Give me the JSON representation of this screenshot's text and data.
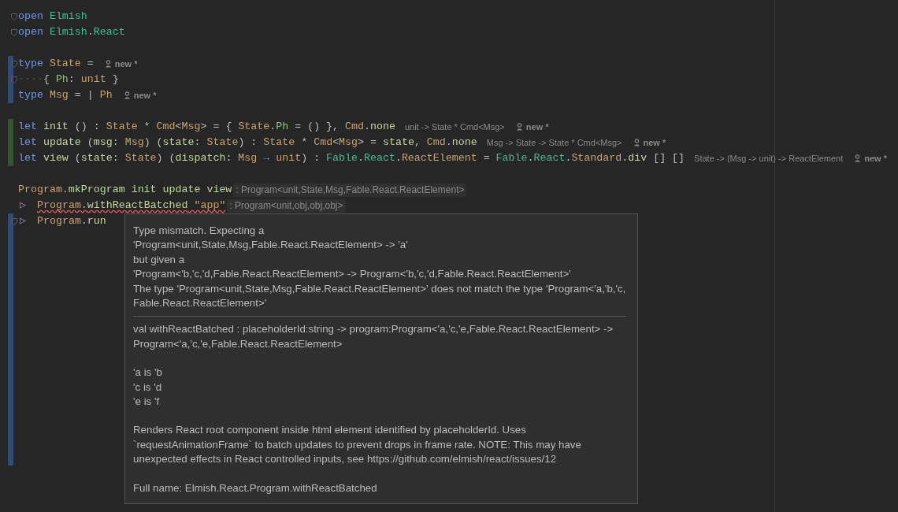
{
  "editor": {
    "blocks": [
      {
        "lines": [
          {
            "fold": true,
            "tokens": [
              {
                "kind": "kw",
                "text": "open "
              },
              {
                "kind": "mod",
                "text": "Elmish"
              }
            ]
          },
          {
            "fold": true,
            "tokens": [
              {
                "kind": "kw",
                "text": "open "
              },
              {
                "kind": "mod",
                "text": "Elmish"
              },
              {
                "kind": "p",
                "text": "."
              },
              {
                "kind": "mod",
                "text": "React"
              }
            ]
          }
        ]
      },
      {
        "lines": [
          {
            "modified": true,
            "fold": true,
            "tokens": [
              {
                "kind": "kw",
                "text": "type "
              },
              {
                "kind": "type",
                "text": "State"
              },
              {
                "kind": "p",
                "text": " ="
              }
            ],
            "author": "new *"
          },
          {
            "modified": true,
            "fold": true,
            "tokens": [
              {
                "kind": "ws",
                "text": "····"
              },
              {
                "kind": "p",
                "text": "{ "
              },
              {
                "kind": "field",
                "text": "Ph"
              },
              {
                "kind": "p",
                "text": ": "
              },
              {
                "kind": "type",
                "text": "unit"
              },
              {
                "kind": "p",
                "text": " }"
              }
            ]
          },
          {
            "modified": true,
            "tokens": [
              {
                "kind": "kw",
                "text": "type "
              },
              {
                "kind": "type",
                "text": "Msg"
              },
              {
                "kind": "p",
                "text": " = | "
              },
              {
                "kind": "type",
                "text": "Ph"
              }
            ],
            "author": "new *"
          }
        ]
      },
      {
        "lines": [
          {
            "added": true,
            "tokens": [
              {
                "kind": "kw",
                "text": "let "
              },
              {
                "kind": "fn",
                "text": "init"
              },
              {
                "kind": "p",
                "text": " () : "
              },
              {
                "kind": "type",
                "text": "State"
              },
              {
                "kind": "p",
                "text": " * "
              },
              {
                "kind": "type",
                "text": "Cmd"
              },
              {
                "kind": "p",
                "text": "<"
              },
              {
                "kind": "type",
                "text": "Msg"
              },
              {
                "kind": "p",
                "text": "> = { "
              },
              {
                "kind": "type",
                "text": "State"
              },
              {
                "kind": "p",
                "text": "."
              },
              {
                "kind": "field",
                "text": "Ph"
              },
              {
                "kind": "p",
                "text": " = () }, "
              },
              {
                "kind": "type",
                "text": "Cmd"
              },
              {
                "kind": "p",
                "text": "."
              },
              {
                "kind": "fn",
                "text": "none"
              }
            ],
            "hint": {
              "kind": "plain",
              "text": "unit -> State * Cmd<Msg>"
            },
            "author": "new *"
          },
          {
            "added": true,
            "tokens": [
              {
                "kind": "kw",
                "text": "let "
              },
              {
                "kind": "fn",
                "text": "update"
              },
              {
                "kind": "p",
                "text": " ("
              },
              {
                "kind": "fn",
                "text": "msg"
              },
              {
                "kind": "p",
                "text": ": "
              },
              {
                "kind": "type",
                "text": "Msg"
              },
              {
                "kind": "p",
                "text": ") ("
              },
              {
                "kind": "fn",
                "text": "state"
              },
              {
                "kind": "p",
                "text": ": "
              },
              {
                "kind": "type",
                "text": "State"
              },
              {
                "kind": "p",
                "text": ") : "
              },
              {
                "kind": "type",
                "text": "State"
              },
              {
                "kind": "p",
                "text": " * "
              },
              {
                "kind": "type",
                "text": "Cmd"
              },
              {
                "kind": "p",
                "text": "<"
              },
              {
                "kind": "type",
                "text": "Msg"
              },
              {
                "kind": "p",
                "text": "> = "
              },
              {
                "kind": "fn",
                "text": "state"
              },
              {
                "kind": "p",
                "text": ", "
              },
              {
                "kind": "type",
                "text": "Cmd"
              },
              {
                "kind": "p",
                "text": "."
              },
              {
                "kind": "fn",
                "text": "none"
              }
            ],
            "hint": {
              "kind": "plain",
              "text": "Msg -> State -> State * Cmd<Msg>"
            },
            "author": "new *"
          },
          {
            "added": true,
            "tokens": [
              {
                "kind": "kw",
                "text": "let "
              },
              {
                "kind": "fn",
                "text": "view"
              },
              {
                "kind": "p",
                "text": " ("
              },
              {
                "kind": "fn",
                "text": "state"
              },
              {
                "kind": "p",
                "text": ": "
              },
              {
                "kind": "type",
                "text": "State"
              },
              {
                "kind": "p",
                "text": ") ("
              },
              {
                "kind": "fn",
                "text": "dispatch"
              },
              {
                "kind": "p",
                "text": ": "
              },
              {
                "kind": "type",
                "text": "Msg"
              },
              {
                "kind": "kw",
                "text": " → "
              },
              {
                "kind": "type",
                "text": "unit"
              },
              {
                "kind": "p",
                "text": ") : "
              },
              {
                "kind": "mod",
                "text": "Fable"
              },
              {
                "kind": "p",
                "text": "."
              },
              {
                "kind": "mod",
                "text": "React"
              },
              {
                "kind": "p",
                "text": "."
              },
              {
                "kind": "type",
                "text": "ReactElement"
              },
              {
                "kind": "p",
                "text": " = "
              },
              {
                "kind": "mod",
                "text": "Fable"
              },
              {
                "kind": "p",
                "text": "."
              },
              {
                "kind": "mod",
                "text": "React"
              },
              {
                "kind": "p",
                "text": "."
              },
              {
                "kind": "type",
                "text": "Standard"
              },
              {
                "kind": "p",
                "text": "."
              },
              {
                "kind": "fn",
                "text": "div"
              },
              {
                "kind": "p",
                "text": " [] []"
              }
            ],
            "hint": {
              "kind": "plain",
              "text": "State -> (Msg -> unit) -> ReactElement"
            },
            "author": "new *"
          }
        ]
      },
      {
        "lines": [
          {
            "tokens": [
              {
                "kind": "type",
                "text": "Program"
              },
              {
                "kind": "p",
                "text": "."
              },
              {
                "kind": "fn",
                "text": "mkProgram"
              },
              {
                "kind": "fn",
                "text": " init"
              },
              {
                "kind": "fn",
                "text": " update"
              },
              {
                "kind": "fn",
                "text": " view"
              }
            ],
            "hint": {
              "kind": "boxed",
              "text": ": Program<unit,State,Msg,Fable.React.ReactElement>"
            }
          },
          {
            "tokens": [
              {
                "kind": "pipe",
                "text": "▷"
              },
              {
                "kind": "type",
                "text": "Program",
                "error": true
              },
              {
                "kind": "p",
                "text": ".",
                "error": true
              },
              {
                "kind": "fn",
                "text": "withReactBatched",
                "error": true
              },
              {
                "kind": "str",
                "text": " \"app\"",
                "error": true
              }
            ],
            "hint": {
              "kind": "boxed",
              "text": ": Program<unit,obj,obj,obj>"
            }
          },
          {
            "modified": true,
            "fold": true,
            "tokens": [
              {
                "kind": "pipe",
                "text": "▷"
              },
              {
                "kind": "type",
                "text": "Program"
              },
              {
                "kind": "p",
                "text": "."
              },
              {
                "kind": "fn",
                "text": "run"
              }
            ]
          },
          {
            "modified": true
          },
          {
            "modified": true
          },
          {
            "modified": true
          },
          {
            "modified": true
          },
          {
            "modified": true
          },
          {
            "modified": true
          },
          {
            "modified": true
          },
          {
            "modified": true
          },
          {
            "modified": true
          },
          {
            "modified": true
          },
          {
            "modified": true
          },
          {
            "modified": true
          },
          {
            "modified": true
          },
          {
            "modified": true
          },
          {
            "modified": true
          }
        ]
      }
    ]
  },
  "tooltip": {
    "error_lines": [
      "Type mismatch. Expecting a",
      "'Program<unit,State,Msg,Fable.React.ReactElement> -> 'a'",
      "but given a",
      "'Program<'b,'c,'d,Fable.React.ReactElement> -> Program<'b,'c,'d,Fable.React.ReactElement>'",
      "The type 'Program<unit,State,Msg,Fable.React.ReactElement>' does not match the type 'Program<'a,'b,'c, Fable.React.ReactElement>'"
    ],
    "signature": "val withReactBatched : placeholderId:string -> program:Program<'a,'c,'e,Fable.React.ReactElement> -> Program<'a,'c,'e,Fable.React.ReactElement>",
    "substitutions": [
      "'a is 'b",
      "'c is 'd",
      "'e is 'f"
    ],
    "description": "Renders React root component inside html element identified by placeholderId. Uses `requestAnimationFrame` to batch updates to prevent drops in frame rate. NOTE: This may have unexpected effects in React controlled inputs, see https://github.com/elmish/react/issues/12",
    "full_name": "Full name: Elmish.React.Program.withReactBatched"
  }
}
